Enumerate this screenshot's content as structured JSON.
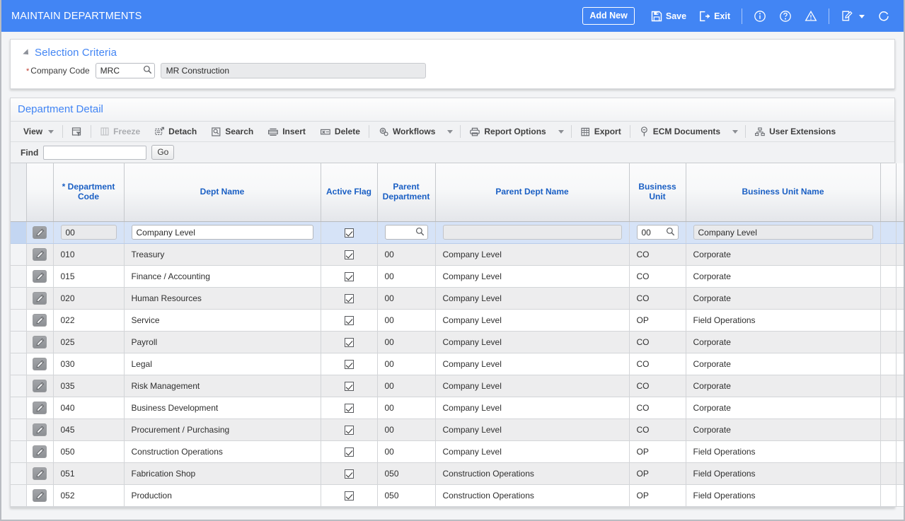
{
  "appbar": {
    "title": "MAINTAIN DEPARTMENTS",
    "add_new_label": "Add New",
    "save_label": "Save",
    "exit_label": "Exit"
  },
  "selection_criteria": {
    "header": "Selection Criteria",
    "company_code_label": "Company Code",
    "company_code_required": "*",
    "company_code_value": "MRC",
    "company_name_value": "MR Construction"
  },
  "detail": {
    "header": "Department Detail",
    "toolbar": {
      "view_label": "View",
      "freeze_label": "Freeze",
      "detach_label": "Detach",
      "search_label": "Search",
      "insert_label": "Insert",
      "delete_label": "Delete",
      "workflows_label": "Workflows",
      "report_options_label": "Report Options",
      "export_label": "Export",
      "ecm_documents_label": "ECM Documents",
      "user_extensions_label": "User Extensions"
    },
    "find": {
      "label": "Find",
      "value": "",
      "go_label": "Go"
    },
    "columns": [
      {
        "id": "dept_code",
        "label": "* Department Code",
        "required": true
      },
      {
        "id": "dept_name",
        "label": "Dept Name"
      },
      {
        "id": "active_flag",
        "label": "Active Flag"
      },
      {
        "id": "parent_department",
        "label": "Parent Department"
      },
      {
        "id": "parent_dept_name",
        "label": "Parent Dept Name"
      },
      {
        "id": "business_unit",
        "label": "Business Unit"
      },
      {
        "id": "business_unit_name",
        "label": "Business Unit Name"
      }
    ],
    "edit_row": {
      "dept_code": "00",
      "dept_name": "Company Level",
      "active_flag": true,
      "parent_department": "",
      "parent_dept_name": "",
      "business_unit": "00",
      "business_unit_name": "Company Level",
      "extra_value": ""
    },
    "rows": [
      {
        "dept_code": "010",
        "dept_name": "Treasury",
        "active_flag": true,
        "parent_department": "00",
        "parent_dept_name": "Company Level",
        "business_unit": "CO",
        "business_unit_name": "Corporate"
      },
      {
        "dept_code": "015",
        "dept_name": "Finance / Accounting",
        "active_flag": true,
        "parent_department": "00",
        "parent_dept_name": "Company Level",
        "business_unit": "CO",
        "business_unit_name": "Corporate"
      },
      {
        "dept_code": "020",
        "dept_name": "Human Resources",
        "active_flag": true,
        "parent_department": "00",
        "parent_dept_name": "Company Level",
        "business_unit": "CO",
        "business_unit_name": "Corporate"
      },
      {
        "dept_code": "022",
        "dept_name": "Service",
        "active_flag": true,
        "parent_department": "00",
        "parent_dept_name": "Company Level",
        "business_unit": "OP",
        "business_unit_name": "Field Operations"
      },
      {
        "dept_code": "025",
        "dept_name": "Payroll",
        "active_flag": true,
        "parent_department": "00",
        "parent_dept_name": "Company Level",
        "business_unit": "CO",
        "business_unit_name": "Corporate"
      },
      {
        "dept_code": "030",
        "dept_name": "Legal",
        "active_flag": true,
        "parent_department": "00",
        "parent_dept_name": "Company Level",
        "business_unit": "CO",
        "business_unit_name": "Corporate"
      },
      {
        "dept_code": "035",
        "dept_name": "Risk Management",
        "active_flag": true,
        "parent_department": "00",
        "parent_dept_name": "Company Level",
        "business_unit": "CO",
        "business_unit_name": "Corporate"
      },
      {
        "dept_code": "040",
        "dept_name": "Business Development",
        "active_flag": true,
        "parent_department": "00",
        "parent_dept_name": "Company Level",
        "business_unit": "CO",
        "business_unit_name": "Corporate"
      },
      {
        "dept_code": "045",
        "dept_name": "Procurement / Purchasing",
        "active_flag": true,
        "parent_department": "00",
        "parent_dept_name": "Company Level",
        "business_unit": "CO",
        "business_unit_name": "Corporate"
      },
      {
        "dept_code": "050",
        "dept_name": "Construction Operations",
        "active_flag": true,
        "parent_department": "00",
        "parent_dept_name": "Company Level",
        "business_unit": "OP",
        "business_unit_name": "Field Operations"
      },
      {
        "dept_code": "051",
        "dept_name": "Fabrication Shop",
        "active_flag": true,
        "parent_department": "050",
        "parent_dept_name": "Construction Operations",
        "business_unit": "OP",
        "business_unit_name": "Field Operations"
      },
      {
        "dept_code": "052",
        "dept_name": "Production",
        "active_flag": true,
        "parent_department": "050",
        "parent_dept_name": "Construction Operations",
        "business_unit": "OP",
        "business_unit_name": "Field Operations"
      }
    ]
  },
  "colors": {
    "brand_blue": "#4285f4",
    "header_text_blue": "#1a5fc4",
    "edit_row_bg": "#d6e3f7"
  }
}
